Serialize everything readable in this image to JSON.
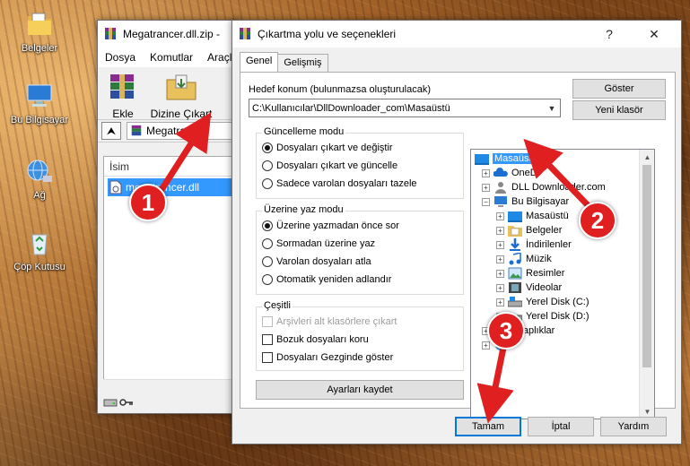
{
  "desktop": {
    "icons": [
      {
        "label": "Belgeler"
      },
      {
        "label": "Bu Bilgisayar"
      },
      {
        "label": "Ağ"
      },
      {
        "label": "Çöp Kutusu"
      }
    ]
  },
  "archive_window": {
    "title": "Megatrancer.dll.zip -",
    "menu": [
      "Dosya",
      "Komutlar",
      "Araçla"
    ],
    "toolbar": {
      "add_label": "Ekle",
      "extract_label": "Dizine Çıkart"
    },
    "address": "Megatrancer",
    "column_name": "İsim",
    "file_name": "megatrancer.dll"
  },
  "dialog": {
    "title": "Çıkartma yolu ve seçenekleri",
    "help_glyph": "?",
    "close_glyph": "✕",
    "tabs": [
      "Genel",
      "Gelişmiş"
    ],
    "dest_label": "Hedef konum (bulunmazsa oluşturulacak)",
    "dest_path": "C:\\Kullanıcılar\\DllDownloader_com\\Masaüstü",
    "show_button": "Göster",
    "new_folder_button": "Yeni klasör",
    "update_mode": {
      "title": "Güncelleme modu",
      "options": [
        "Dosyaları çıkart ve değiştir",
        "Dosyaları çıkart ve güncelle",
        "Sadece varolan dosyaları tazele"
      ],
      "selected": 0
    },
    "overwrite_mode": {
      "title": "Üzerine yaz modu",
      "options": [
        "Üzerine yazmadan önce sor",
        "Sormadan üzerine yaz",
        "Varolan dosyaları atla",
        "Otomatik yeniden adlandır"
      ],
      "selected": 0
    },
    "misc": {
      "title": "Çeşitli",
      "options": [
        "Arşivleri alt klasörlere çıkart",
        "Bozuk dosyaları koru",
        "Dosyaları Gezginde göster"
      ],
      "disabled": [
        true,
        false,
        false
      ],
      "checked": [
        false,
        false,
        false
      ]
    },
    "save_settings_button": "Ayarları kaydet",
    "tree": {
      "items": [
        {
          "label": "Masaüstü",
          "icon": "desktop-folder-icon",
          "selected": true
        },
        {
          "label": "OneDr",
          "icon": "onedrive-icon"
        },
        {
          "label": "DLL Downloader.com",
          "icon": "user-folder-icon"
        },
        {
          "label": "Bu Bilgisayar",
          "icon": "computer-icon"
        },
        {
          "label": "Masaüstü",
          "icon": "desktop-folder-icon"
        },
        {
          "label": "Belgeler",
          "icon": "documents-icon"
        },
        {
          "label": "İndirilenler",
          "icon": "download-icon"
        },
        {
          "label": "Müzik",
          "icon": "music-icon"
        },
        {
          "label": "Resimler",
          "icon": "pictures-icon"
        },
        {
          "label": "Videolar",
          "icon": "videos-icon"
        },
        {
          "label": "Yerel Disk (C:)",
          "icon": "drive-icon"
        },
        {
          "label": "Yerel Disk (D:)",
          "icon": "drive-icon"
        },
        {
          "label": "Kitaplıklar",
          "icon": "libraries-icon"
        },
        {
          "label": "",
          "icon": "network-icon"
        }
      ]
    },
    "ok_button": "Tamam",
    "cancel_button": "İptal",
    "help_button": "Yardım"
  },
  "annotations": {
    "step1": "1",
    "step2": "2",
    "step3": "3",
    "color": "#e02020"
  }
}
